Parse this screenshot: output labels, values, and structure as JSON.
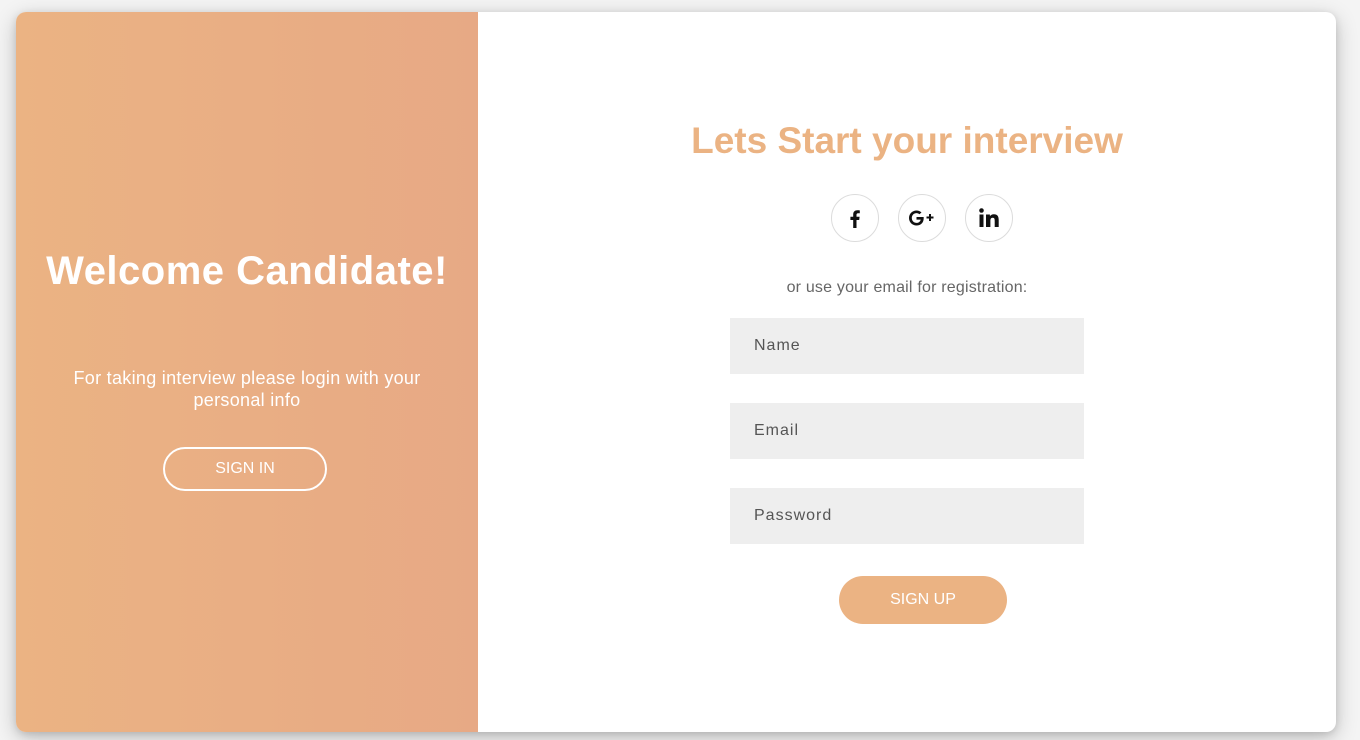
{
  "welcome_panel": {
    "title": "Welcome Candidate!",
    "text": "For taking interview please login with your personal info",
    "signin_label": "SIGN IN"
  },
  "signup_panel": {
    "title": "Lets Start your interview",
    "social": [
      "facebook-icon",
      "google-plus-icon",
      "linkedin-icon"
    ],
    "or_text": "or use your email for registration:",
    "fields": {
      "name_placeholder": "Name",
      "email_placeholder": "Email",
      "password_placeholder": "Password"
    },
    "signup_label": "SIGN UP"
  },
  "colors": {
    "accent": "#ebb383",
    "gradient_start": "#ebb383",
    "gradient_end": "#e7a985",
    "input_bg": "#eeeeee"
  }
}
